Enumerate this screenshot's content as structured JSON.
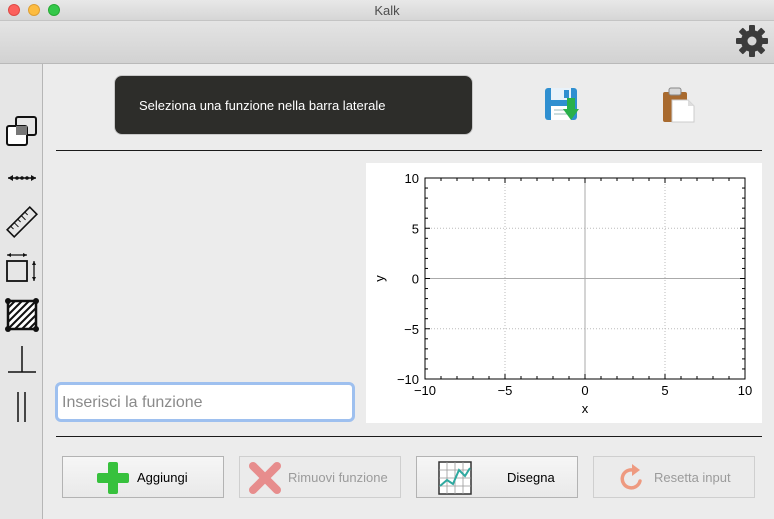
{
  "window": {
    "title": "Kalk"
  },
  "banner": {
    "text": "Seleziona una funzione nella barra laterale"
  },
  "input": {
    "placeholder": "Inserisci la funzione"
  },
  "buttons": {
    "add": "Aggiungi",
    "remove": "Rimuovi funzione",
    "draw": "Disegna",
    "reset": "Resetta input"
  },
  "sidebar": {
    "icons": [
      "overlap-squares-icon",
      "distance-arrow-icon",
      "ruler-icon",
      "resize-box-icon",
      "hatched-square-icon",
      "perpendicular-icon",
      "parallel-icon"
    ]
  },
  "chart_data": {
    "type": "line",
    "series": [],
    "xlabel": "x",
    "ylabel": "y",
    "xlim": [
      -10,
      10
    ],
    "ylim": [
      -10,
      10
    ],
    "xticks": [
      -10,
      -5,
      0,
      5,
      10
    ],
    "yticks": [
      10,
      5,
      0,
      -5,
      -10
    ],
    "grid": true
  }
}
